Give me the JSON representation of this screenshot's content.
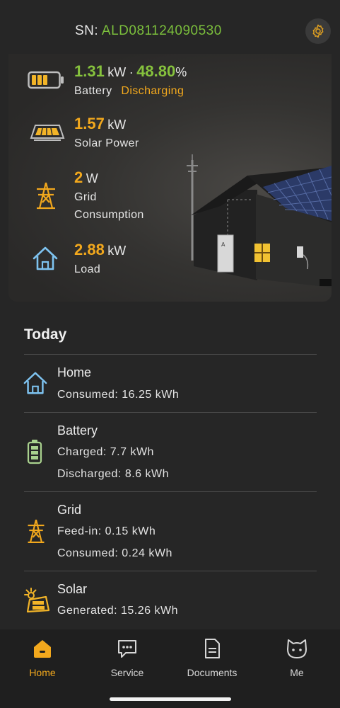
{
  "header": {
    "sn_label": "SN:",
    "sn_value": "ALD081124090530",
    "settings_icon": "gear-icon"
  },
  "hero": {
    "battery": {
      "power_value": "1.31",
      "power_unit": "kW",
      "separator": "·",
      "soc_value": "48.80",
      "soc_unit": "%",
      "label": "Battery",
      "status": "Discharging"
    },
    "solar": {
      "value": "1.57",
      "unit": "kW",
      "label": "Solar Power"
    },
    "grid": {
      "value": "2",
      "unit": "W",
      "label_line1": "Grid",
      "label_line2": "Consumption"
    },
    "load": {
      "value": "2.88",
      "unit": "kW",
      "label": "Load"
    }
  },
  "today": {
    "title": "Today",
    "home": {
      "title": "Home",
      "line1": "Consumed: 16.25 kWh"
    },
    "battery": {
      "title": "Battery",
      "line1": "Charged: 7.7 kWh",
      "line2": "Discharged: 8.6 kWh"
    },
    "grid": {
      "title": "Grid",
      "line1": "Feed-in: 0.15 kWh",
      "line2": "Consumed: 0.24 kWh"
    },
    "solar": {
      "title": "Solar",
      "line1": "Generated: 15.26 kWh"
    }
  },
  "tabs": [
    {
      "label": "Home",
      "icon": "home-icon",
      "active": true
    },
    {
      "label": "Service",
      "icon": "chat-icon",
      "active": false
    },
    {
      "label": "Documents",
      "icon": "document-icon",
      "active": false
    },
    {
      "label": "Me",
      "icon": "cat-face-icon",
      "active": false
    }
  ],
  "colors": {
    "accent_orange": "#f2a81d",
    "accent_green": "#86c23d",
    "sn_green": "#7bbf3c",
    "background": "#262626",
    "tabbar": "#1f1f1f"
  }
}
